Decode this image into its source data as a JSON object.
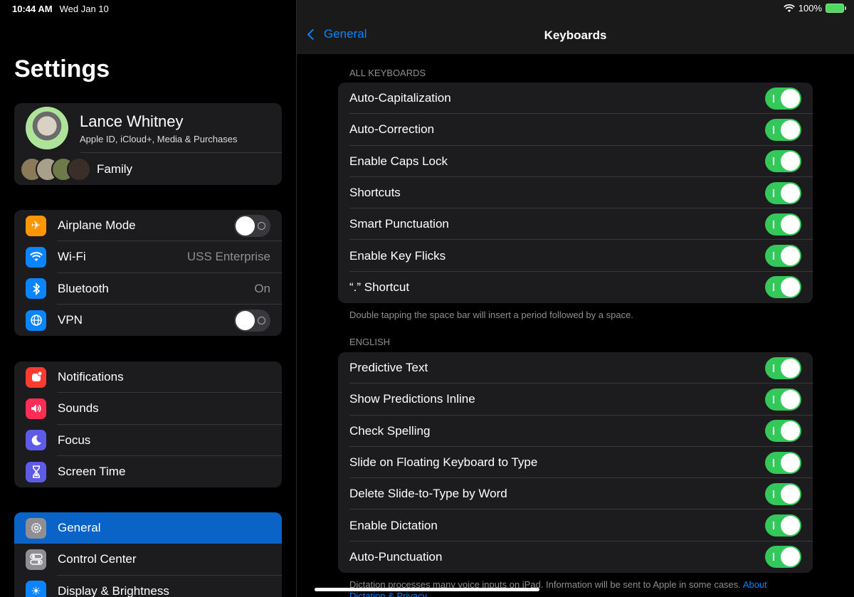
{
  "status": {
    "time": "10:44 AM",
    "date": "Wed Jan 10",
    "battery": "100%"
  },
  "sidebar": {
    "title": "Settings",
    "profile": {
      "name": "Lance Whitney",
      "subtitle": "Apple ID, iCloud+, Media & Purchases",
      "family_label": "Family"
    },
    "connectivity": [
      {
        "label": "Airplane Mode",
        "icon": "airplane-icon",
        "color": "#ff9500",
        "control": "toggle",
        "on": false
      },
      {
        "label": "Wi-Fi",
        "icon": "wifi-icon",
        "color": "#0a84ff",
        "value": "USS Enterprise"
      },
      {
        "label": "Bluetooth",
        "icon": "bluetooth-icon",
        "color": "#0a84ff",
        "value": "On"
      },
      {
        "label": "VPN",
        "icon": "vpn-globe-icon",
        "color": "#0a84ff",
        "control": "toggle",
        "on": false
      }
    ],
    "attention": [
      {
        "label": "Notifications",
        "icon": "notifications-icon",
        "color": "#ff3b30"
      },
      {
        "label": "Sounds",
        "icon": "sounds-icon",
        "color": "#ff2d55"
      },
      {
        "label": "Focus",
        "icon": "moon-icon",
        "color": "#5e5ce6"
      },
      {
        "label": "Screen Time",
        "icon": "hourglass-icon",
        "color": "#5e5ce6"
      }
    ],
    "system": [
      {
        "label": "General",
        "icon": "gear-icon",
        "color": "#8e8e93",
        "selected": true
      },
      {
        "label": "Control Center",
        "icon": "switches-icon",
        "color": "#8e8e93"
      },
      {
        "label": "Display & Brightness",
        "icon": "sun-icon",
        "color": "#0a84ff"
      }
    ]
  },
  "detail": {
    "back_label": "General",
    "title": "Keyboards",
    "all_keyboards_header": "ALL KEYBOARDS",
    "all_keyboards": [
      {
        "label": "Auto-Capitalization",
        "on": true
      },
      {
        "label": "Auto-Correction",
        "on": true
      },
      {
        "label": "Enable Caps Lock",
        "on": true
      },
      {
        "label": "Shortcuts",
        "on": true
      },
      {
        "label": "Smart Punctuation",
        "on": true
      },
      {
        "label": "Enable Key Flicks",
        "on": true
      },
      {
        "label": "“.” Shortcut",
        "on": true
      }
    ],
    "all_keyboards_footer": "Double tapping the space bar will insert a period followed by a space.",
    "english_header": "ENGLISH",
    "english": [
      {
        "label": "Predictive Text",
        "on": true
      },
      {
        "label": "Show Predictions Inline",
        "on": true
      },
      {
        "label": "Check Spelling",
        "on": true
      },
      {
        "label": "Slide on Floating Keyboard to Type",
        "on": true
      },
      {
        "label": "Delete Slide-to-Type by Word",
        "on": true
      },
      {
        "label": "Enable Dictation",
        "on": true
      },
      {
        "label": "Auto-Punctuation",
        "on": true
      }
    ],
    "english_footer": "Dictation processes many voice inputs on iPad. Information will be sent to Apple in some cases.",
    "english_footer_link": "About Dictation & Privacy…"
  }
}
